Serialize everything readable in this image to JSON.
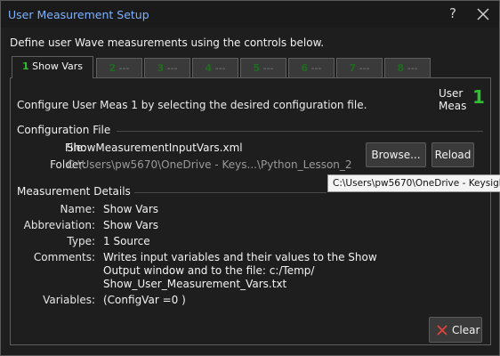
{
  "window": {
    "title": "User Measurement Setup",
    "help_label": "?"
  },
  "intro": "Define user Wave measurements using the controls below.",
  "tabs": [
    {
      "num": "1",
      "label": " Show Vars"
    },
    {
      "num": "2",
      "label": " ---"
    },
    {
      "num": "3",
      "label": " ---"
    },
    {
      "num": "4",
      "label": " ---"
    },
    {
      "num": "5",
      "label": " ---"
    },
    {
      "num": "6",
      "label": " ---"
    },
    {
      "num": "7",
      "label": " ---"
    },
    {
      "num": "8",
      "label": " ---"
    }
  ],
  "panel": {
    "config_text": "Configure User Meas 1 by selecting the desired configuration file.",
    "user_meas_line1": "User",
    "user_meas_line2": "Meas",
    "user_meas_num": "1",
    "config_section": {
      "title": "Configuration File",
      "file_label": "File:",
      "file_value": "ShowMeasurementInputVars.xml",
      "folder_label": "Folder:",
      "folder_value": "C:\\Users\\pw5670\\OneDrive - Keys...\\Python_Lesson_2",
      "browse_label": "Browse...",
      "reload_label": "Reload",
      "tooltip": "C:\\Users\\pw5670\\OneDrive - Keysight"
    },
    "details": {
      "title": "Measurement Details",
      "name_label": "Name:",
      "name_value": "Show Vars",
      "abbr_label": "Abbreviation:",
      "abbr_value": "Show Vars",
      "type_label": "Type:",
      "type_value": "1 Source",
      "comments_label": "Comments:",
      "comments_value": "Writes input variables and their values to the Show Output window and to the file: c:/Temp/ Show_User_Measurement_Vars.txt",
      "variables_label": "Variables:",
      "variables_value": "(ConfigVar =0 )"
    },
    "clear_label": "Clear"
  },
  "colors": {
    "accent_title": "#7eb1ff",
    "tab_number": "#2fbf2f",
    "clear_icon": "#e0423a"
  }
}
